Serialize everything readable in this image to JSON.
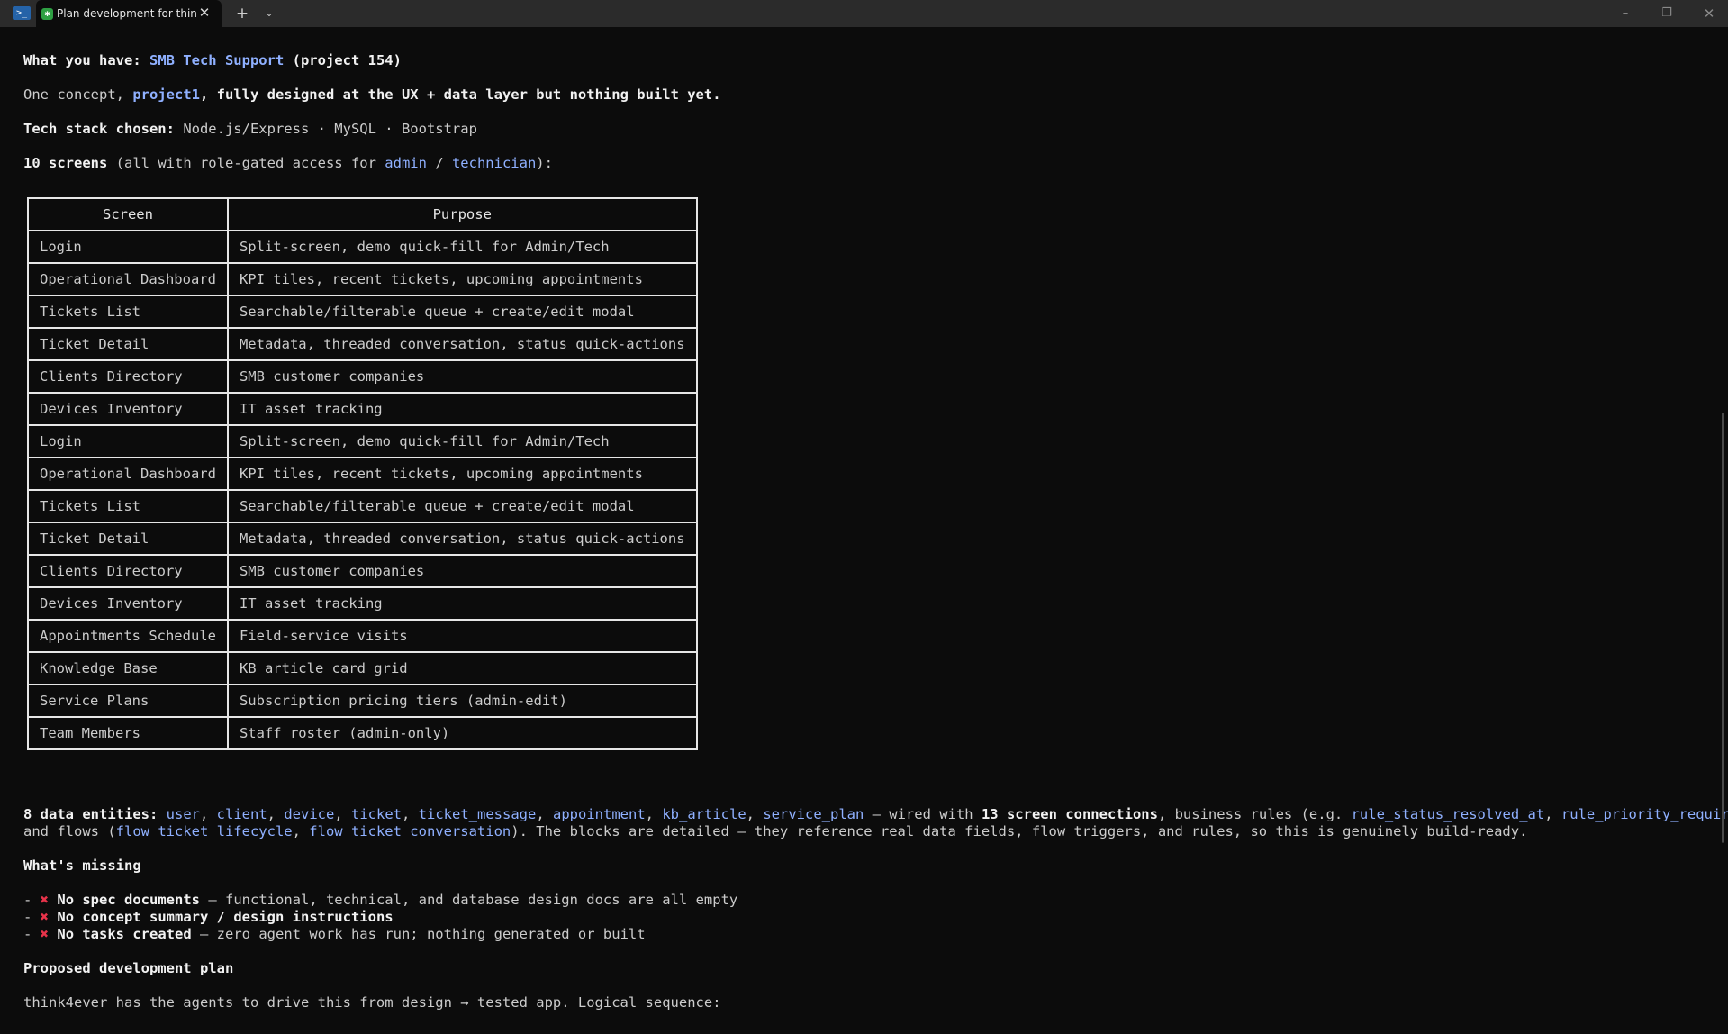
{
  "window": {
    "tab_title": "Plan development for thin",
    "terminal_icon": ">_",
    "new_tab": "+",
    "dropdown": "⌄",
    "minimize": "–",
    "maximize": "❐",
    "close": "✕",
    "tab_close": "✕"
  },
  "intro": {
    "have_label": "What you have: ",
    "have_project": "SMB Tech Support",
    "have_suffix": " (project 154)",
    "concept_prefix": "One concept, ",
    "concept_name": "project1",
    "concept_suffix": ", fully designed at the UX + data layer but nothing built yet.",
    "stack_label": "Tech stack chosen:",
    "stack_value": " Node.js/Express · MySQL · Bootstrap",
    "screens_count": "10 screens",
    "screens_mid": " (all with role-gated access for ",
    "role_admin": "admin",
    "role_sep": " / ",
    "role_tech": "technician",
    "screens_end": "):"
  },
  "table": {
    "headers": [
      "Screen",
      "Purpose"
    ],
    "rows": [
      [
        "Login",
        "Split-screen, demo quick-fill for Admin/Tech"
      ],
      [
        "Operational Dashboard",
        "KPI tiles, recent tickets, upcoming appointments"
      ],
      [
        "Tickets List",
        "Searchable/filterable queue + create/edit modal"
      ],
      [
        "Ticket Detail",
        "Metadata, threaded conversation, status quick-actions"
      ],
      [
        "Clients Directory",
        "SMB customer companies"
      ],
      [
        "Devices Inventory",
        "IT asset tracking"
      ],
      [
        "Login",
        "Split-screen, demo quick-fill for Admin/Tech"
      ],
      [
        "Operational Dashboard",
        "KPI tiles, recent tickets, upcoming appointments"
      ],
      [
        "Tickets List",
        "Searchable/filterable queue + create/edit modal"
      ],
      [
        "Ticket Detail",
        "Metadata, threaded conversation, status quick-actions"
      ],
      [
        "Clients Directory",
        "SMB customer companies"
      ],
      [
        "Devices Inventory",
        "IT asset tracking"
      ],
      [
        "Appointments Schedule",
        "Field-service visits"
      ],
      [
        "Knowledge Base",
        "KB article card grid"
      ],
      [
        "Service Plans",
        "Subscription pricing tiers (admin-edit)"
      ],
      [
        "Team Members",
        "Staff roster (admin-only)"
      ]
    ]
  },
  "entities": {
    "label": "8 data entities:",
    "items": [
      "user",
      "client",
      "device",
      "ticket",
      "ticket_message",
      "appointment",
      "kb_article",
      "service_plan"
    ],
    "sep": ", ",
    "wired": " — wired with ",
    "connections": "13 screen connections",
    "rules_text": ", business rules (e.g. ",
    "rule1": "rule_status_resolved_at",
    "rule2": "rule_priority_required",
    "close_paren": ")",
    "flows_prefix": "and flows (",
    "flow1": "flow_ticket_lifecycle",
    "flow2": "flow_ticket_conversation",
    "flows_suffix": "). The blocks are detailed — they reference real data fields, flow triggers, and rules, so this is genuinely build-ready."
  },
  "missing": {
    "heading": "What's missing",
    "dash": "- ",
    "mark": "✖",
    "items": [
      {
        "bold": "No spec documents",
        "rest": " — functional, technical, and database design docs are all empty"
      },
      {
        "bold": "No concept summary / design instructions",
        "rest": ""
      },
      {
        "bold": "No tasks created",
        "rest": " — zero agent work has run; nothing generated or built"
      }
    ]
  },
  "plan": {
    "heading": "Proposed development plan",
    "text": "think4ever has the agents to drive this from design → tested app. Logical sequence:"
  }
}
